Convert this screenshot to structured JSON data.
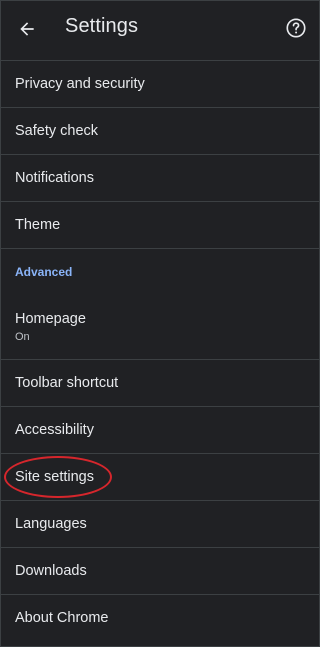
{
  "appbar": {
    "title": "Settings",
    "back_icon": "arrow-left-icon",
    "help_icon": "help-circle-icon"
  },
  "items": [
    {
      "label": "Privacy and security"
    },
    {
      "label": "Safety check"
    },
    {
      "label": "Notifications"
    },
    {
      "label": "Theme"
    }
  ],
  "advanced_section": {
    "label": "Advanced"
  },
  "advanced_items": [
    {
      "label": "Homepage",
      "sublabel": "On"
    },
    {
      "label": "Toolbar shortcut"
    },
    {
      "label": "Accessibility"
    },
    {
      "label": "Site settings",
      "highlighted": true
    },
    {
      "label": "Languages"
    },
    {
      "label": "Downloads"
    },
    {
      "label": "About Chrome"
    }
  ],
  "colors": {
    "background": "#202124",
    "divider": "#3c4043",
    "text": "#e8eaed",
    "section_accent": "#8ab4f8",
    "highlight_circle": "#d6262c"
  }
}
